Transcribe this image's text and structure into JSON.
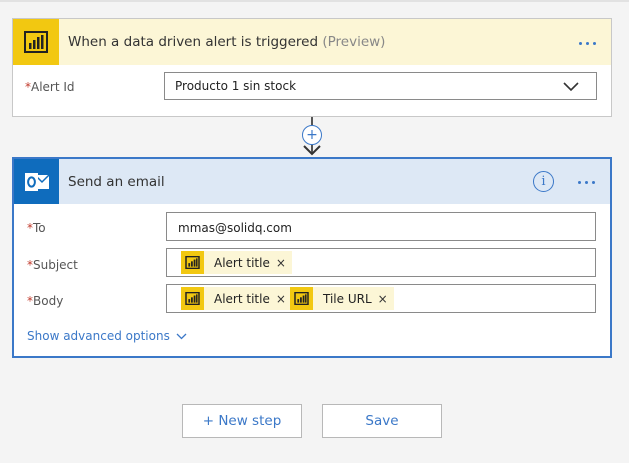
{
  "trigger": {
    "title": "When a data driven alert is triggered",
    "preview": "(Preview)",
    "icon": "powerbi-icon",
    "field": {
      "required_mark": "*",
      "label": "Alert Id",
      "value": "Producto 1 sin stock"
    }
  },
  "action": {
    "title": "Send an email",
    "icon": "outlook-icon",
    "to": {
      "required_mark": "*",
      "label": "To",
      "value": "mmas@solidq.com"
    },
    "subject": {
      "required_mark": "*",
      "label": "Subject",
      "tokens": [
        {
          "label": "Alert title",
          "remove": "×"
        }
      ]
    },
    "body": {
      "required_mark": "*",
      "label": "Body",
      "tokens": [
        {
          "label": "Alert title",
          "remove": "×"
        },
        {
          "label": "Tile URL",
          "remove": "×"
        }
      ]
    },
    "advanced_label": "Show advanced options"
  },
  "buttons": {
    "new_step": "+ New step",
    "save": "Save"
  },
  "colors": {
    "accent": "#3b78c8",
    "powerbi_yellow": "#f2c811",
    "trigger_header": "#fcf6d6",
    "action_header": "#dde8f5",
    "outlook_blue": "#0f6cbd",
    "required": "#c0392b"
  }
}
